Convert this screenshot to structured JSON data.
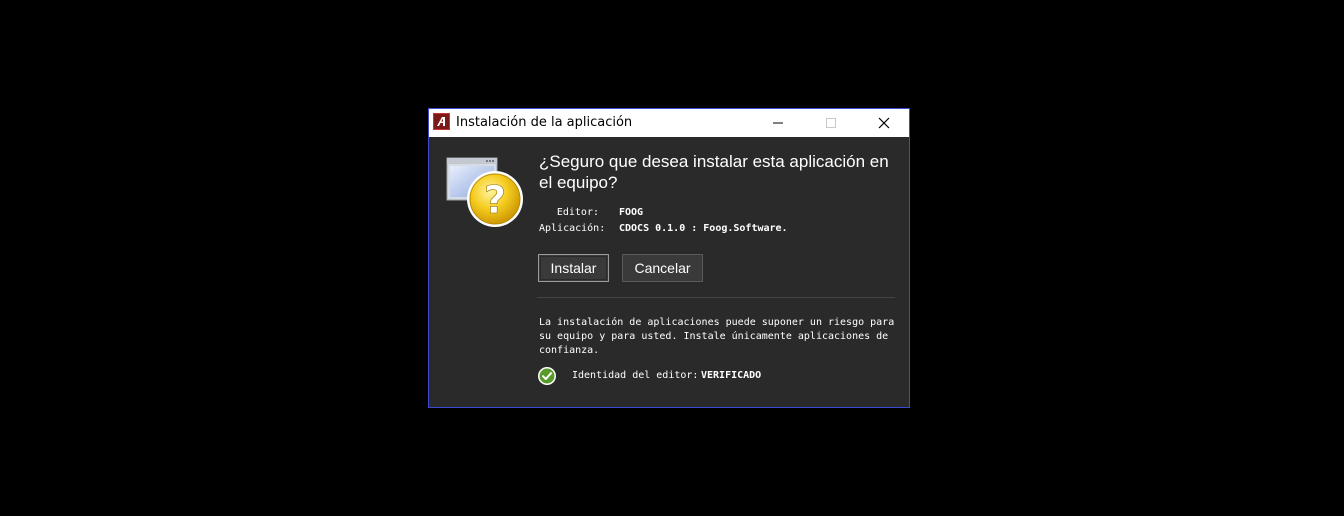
{
  "window": {
    "title": "Instalación de la aplicación",
    "border_color": "#3b4bd6"
  },
  "dialog": {
    "heading": "¿Seguro que desea instalar esta aplicación en el equipo?",
    "editor_label": "Editor:",
    "editor_value": "FOOG",
    "app_label": "Aplicación:",
    "app_value": "CDOCS 0.1.0 : Foog.Software.",
    "install_button": "Instalar",
    "cancel_button": "Cancelar",
    "warning_text": "La instalación de aplicaciones puede suponer un riesgo para su equipo y para usted. Instale únicamente aplicaciones de confianza.",
    "identity_label": "Identidad del editor:",
    "identity_value": "VERIFICADO"
  },
  "icons": {
    "app_logo": "adobe-air-icon",
    "question": "question-mark-icon",
    "verified": "checkmark-icon",
    "minimize": "minimize-icon",
    "maximize": "maximize-icon",
    "close": "close-icon"
  },
  "colors": {
    "dialog_background": "#2a2a2a",
    "verified_green": "#5a9a2a",
    "question_yellow": "#f2c31a"
  }
}
